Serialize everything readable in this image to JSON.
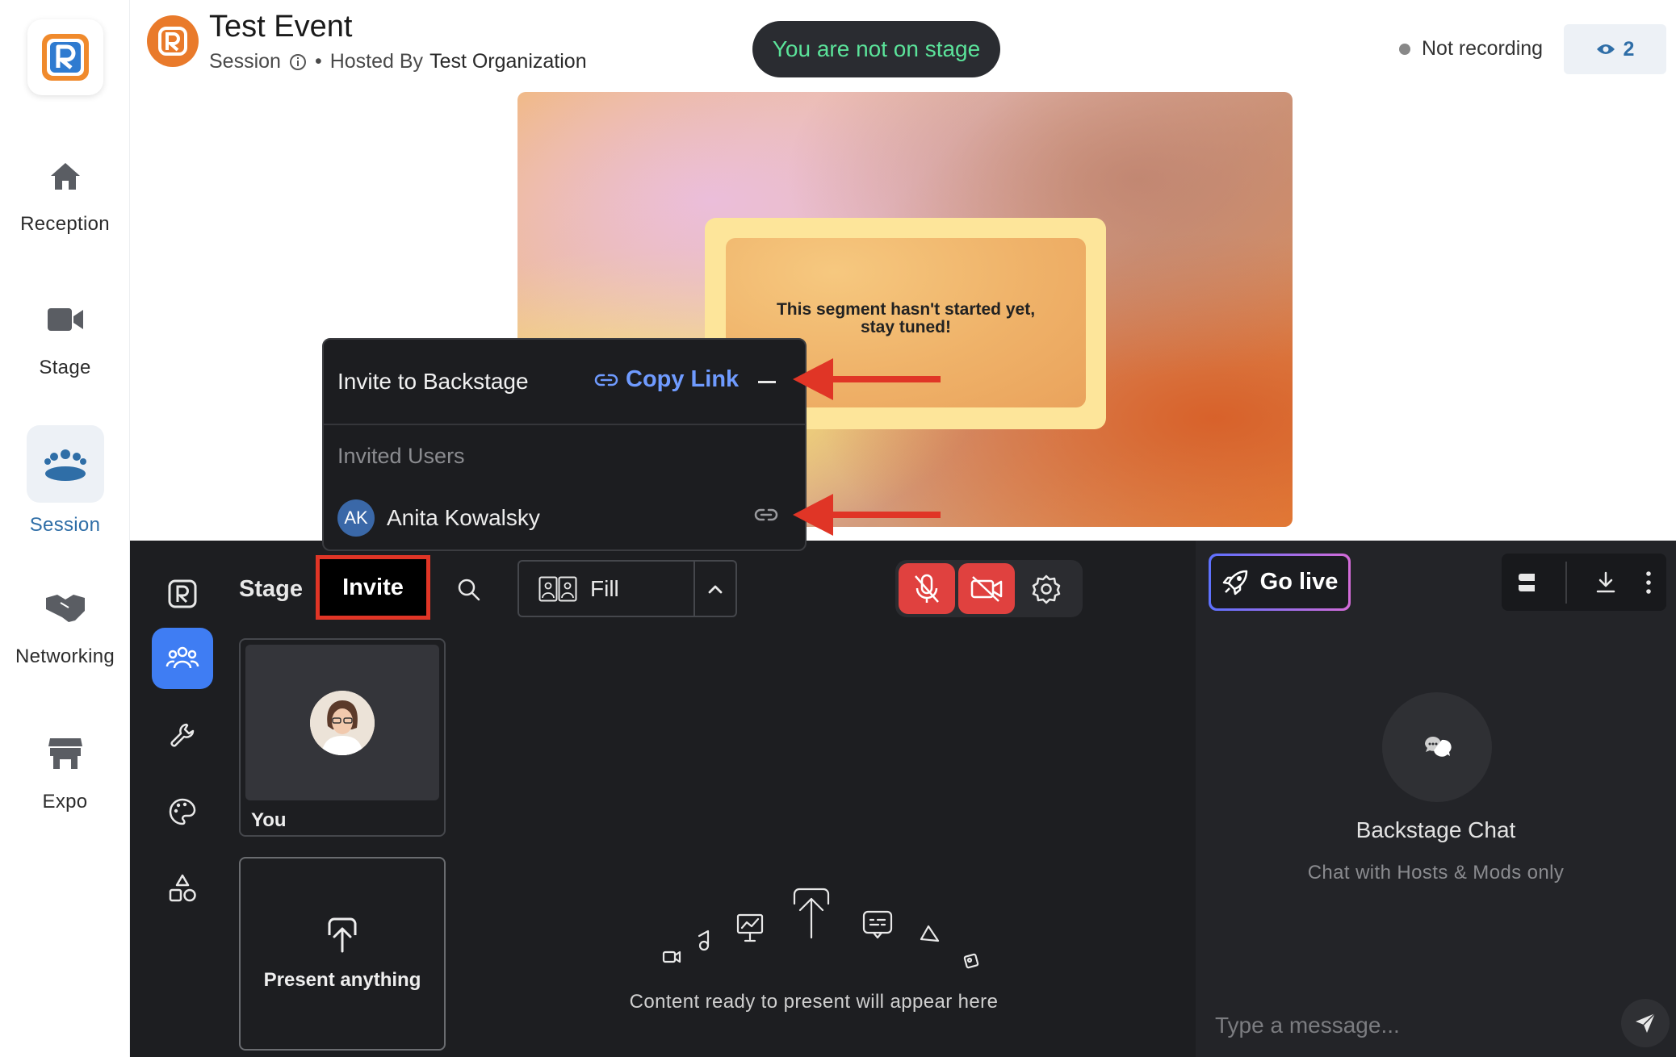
{
  "nav": {
    "items": [
      {
        "label": "Reception",
        "icon": "home-icon"
      },
      {
        "label": "Stage",
        "icon": "video-camera-icon"
      },
      {
        "label": "Session",
        "icon": "people-group-icon",
        "active": true
      },
      {
        "label": "Networking",
        "icon": "handshake-icon"
      },
      {
        "label": "Expo",
        "icon": "booth-icon"
      }
    ]
  },
  "header": {
    "title": "Test Event",
    "session_label": "Session",
    "hosted_prefix": "Hosted By",
    "organization": "Test Organization",
    "stage_status": "You are not on stage",
    "recording_status": "Not recording",
    "viewer_count": "2"
  },
  "preview": {
    "message": "This segment hasn't started yet, stay tuned!"
  },
  "studio": {
    "tabs": [
      {
        "label": "Stage"
      },
      {
        "label": "Invite",
        "active": true
      }
    ],
    "layout_mode": "Fill",
    "tiles": {
      "you_label": "You",
      "present_label": "Present anything"
    },
    "empty_state": "Content ready to present will appear here"
  },
  "invite_popover": {
    "title": "Invite to Backstage",
    "copy_link_label": "Copy Link",
    "invited_heading": "Invited Users",
    "users": [
      {
        "initials": "AK",
        "name": "Anita Kowalsky"
      }
    ]
  },
  "chat": {
    "go_live_label": "Go live",
    "title": "Backstage Chat",
    "subtitle": "Chat with Hosts & Mods only",
    "input_placeholder": "Type a message..."
  },
  "colors": {
    "accent_blue": "#3f7df3",
    "link_blue": "#6f9bff",
    "stage_green": "#5be39a",
    "muted_red": "#e0413f",
    "annotation_red": "#e03526",
    "brand_orange": "#e97a2b"
  }
}
